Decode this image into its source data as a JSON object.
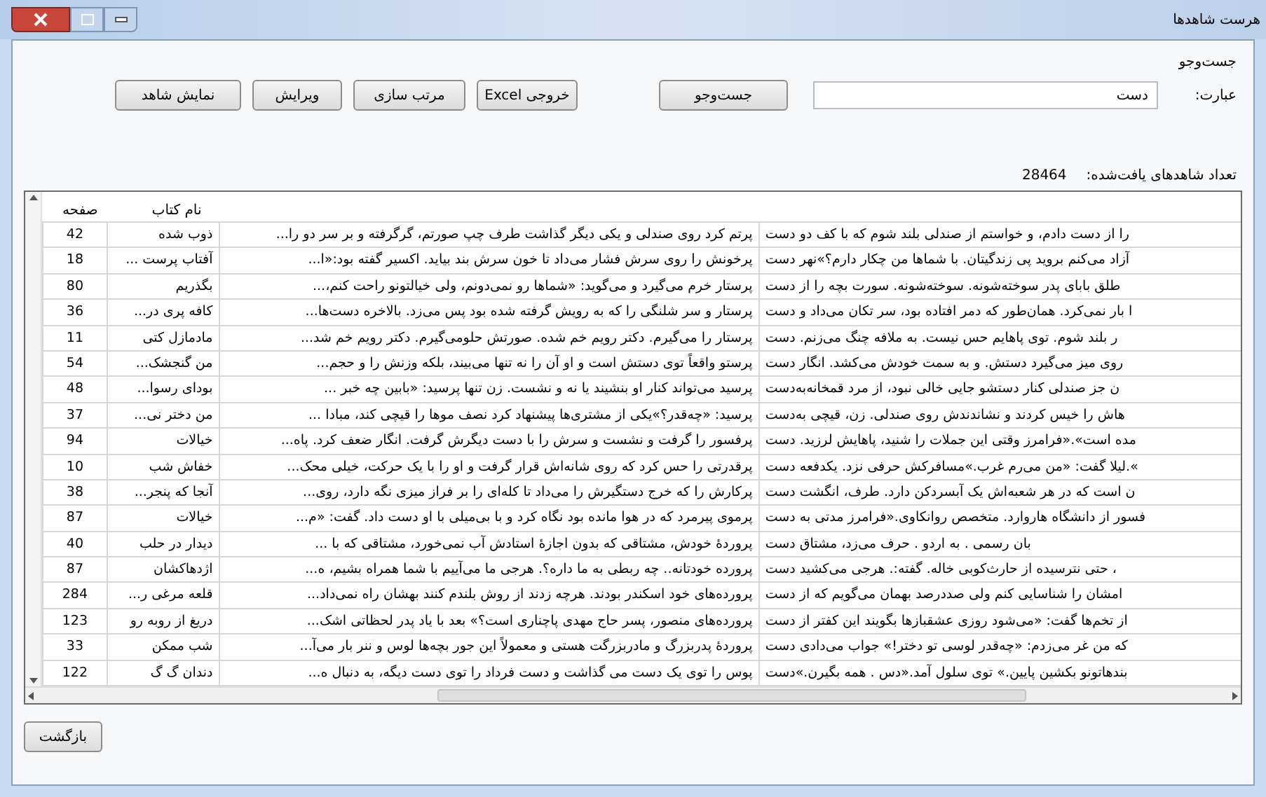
{
  "window": {
    "title": "هرست شاهدها"
  },
  "search_group": {
    "label": "جست‌وجو",
    "phrase_label": "عبارت:",
    "phrase_value": "دست",
    "search_button": "جست‌وجو",
    "buttons": [
      "خروجی Excel",
      "مرتب سازی",
      "ویرایش",
      "نمایش شاهد"
    ]
  },
  "found": {
    "label": "تعداد شاهدهای یافت‌شده:",
    "count": "28464"
  },
  "table": {
    "columns": {
      "book": "نام کتاب",
      "page": "صفحه"
    },
    "rows": [
      {
        "column_1": "را از دست دادم، و خواستم از صندلی بلند شوم که با کف دو دست",
        "column_2": "پرتم کرد روی صندلی و یکی دیگر گذاشت طرف چپ صورتم، گرگرفته و بر سر دو را...",
        "book": "ذوب شده",
        "page": "42"
      },
      {
        "column_1": "آزاد می‌کنم بروید پی زندگیتان. با شماها من چکار دارم؟»نهر دست",
        "column_2": "پرخونش را روی سرش فشار می‌داد تا خون سرش بند بیاید. اکسیر گفته بود:«ا...",
        "book": "آفتاب پرست ...",
        "page": "18"
      },
      {
        "column_1": "طلق بابای پدر سوخته‌شونه. سوخته‌شونه. سورت بچه را از دست",
        "column_2": "پرستار خرم می‌گیرد و می‌گوید: «شماها رو نمی‌دونم، ولی خیالتونو راحت کنم،...",
        "book": "بگذریم",
        "page": "80"
      },
      {
        "column_1": "ا بار نمی‌کرد. همان‌طور که دمر افتاده بود، سر تکان می‌داد و دست",
        "column_2": "پرستار و سر شلنگی را که به رویش گرفته شده بود پس می‌زد. بالاخره دست‌ها...",
        "book": "کافه پری در...",
        "page": "36"
      },
      {
        "column_1": "ر بلند شوم. توی پاهایم حس نیست. به ملافه چنگ می‌زنم. دست",
        "column_2": "پرستار را می‌گیرم. دکتر رویم خم شده. صورتش حلومی‌گیرم. دکتر رویم خم شد...",
        "book": "مادمازل کتی",
        "page": "11"
      },
      {
        "column_1": "روی میز می‌گیرد دستش. و به سمت خودش می‌کشد. انگار دست",
        "column_2": "پرستو واقعاً توی دستش است و او آن را نه تنها می‌بیند، بلکه وزنش را و حجم...",
        "book": "من گنجشک...",
        "page": "54"
      },
      {
        "column_1": "ن جز صندلی کنار دستشو جایی خالی نبود، از مرد قمخانه‌به‌دست",
        "column_2": "پرسید می‌تواند کنار او بنشیند یا نه و نشست. زن تنها پرسید: «بابین چه خبر ...",
        "book": "بودای رسوا...",
        "page": "48"
      },
      {
        "column_1": "هاش را خیس کردند و نشاندندش روی صندلی. زن، قیچی به‌دست",
        "column_2": "پرسید: «چه‌قدر؟»یکی از مشتری‌ها پیشنهاد کرد نصف موها را قیچی کند، مبادا ...",
        "book": "من دختر نی...",
        "page": "37"
      },
      {
        "column_1": "مده است».«فرامرز وقتی این جملات را شنید، پاهایش لرزید. دست",
        "column_2": "پرفسور را گرفت و نشست و سرش را با دست دیگرش گرفت. انگار ضعف کرد. پاه...",
        "book": "خیالات",
        "page": "94"
      },
      {
        "column_1": "».لیلا گفت: «من می‌رم غرب.»مسافرکش حرفی نزد. یکدفعه دست",
        "column_2": "پرقدرتی را حس کرد که روی شانه‌اش قرار گرفت و او را با یک حرکت، خیلی محک...",
        "book": "خفاش شب",
        "page": "10"
      },
      {
        "column_1": "ن است که در هر شعبه‌اش یک آبسردکن دارد. طرف، انگشت دست",
        "column_2": "پرکارش را که خرج دستگیرش را می‌داد تا کله‌ای را بر فراز میزی نگه دارد، روی...",
        "book": "آنجا که پنجر...",
        "page": "38"
      },
      {
        "column_1": "فسور از دانشگاه هاروارد. متخصص روانکاوی.«فرامرز مدتی به دست",
        "column_2": "پرموی پیرمرد که در هوا مانده بود نگاه کرد و با بی‌میلی با او دست داد. گفت: «م...",
        "book": "خیالات",
        "page": "87"
      },
      {
        "column_1": "بان رسمی . به اردو . حرف می‌زد، مشتاق دست",
        "column_2": "پروردهٔ خودش، مشتاقی که بدون اجازهٔ استادش آب نمی‌خورد، مشتاقی که با ...",
        "book": "دیدار در حلب",
        "page": "40"
      },
      {
        "column_1": "، حتی نترسیده از حارث‌کوبی خاله. گفته:. هرجی می‌کشید دست",
        "column_2": "پرورده خودتانه.. چه ربطی به ما داره؟. هرجی ما می‌آییم با شما همراه بشیم، ه...",
        "book": "اژدهاکشان",
        "page": "87"
      },
      {
        "column_1": "امشان را شناسایی کنم ولی صددرصد بهمان می‌گویم که از دست",
        "column_2": "پرورده‌های خود اسکندر بودند. هرچه زدند از روش بلندم کنند بهشان راه نمی‌داد...",
        "book": "قلعه مرغی ر...",
        "page": "284"
      },
      {
        "column_1": "از تخم‌ها گفت: «می‌شود روزی عشقبازها بگویند این کفتر از دست",
        "column_2": "پرورده‌های منصور، پسر حاج مهدی پاچناری است؟» بعد با یاد پدر لحظاتی اشک...",
        "book": "دریغ از روبه رو",
        "page": "123"
      },
      {
        "column_1": "که من غر می‌زدم: «چه‌قدر لوسی تو دختر!» جواب می‌دادی دست",
        "column_2": "پروردهٔ پدربزرگ و مادربزرگت هستی و معمولاً این جور بچه‌ها لوس و ننر بار می‌آ...",
        "book": "شب ممکن",
        "page": "33"
      },
      {
        "column_1": "بندهاتونو بکشین پایین.» توی سلول آمد.«دس . همه بگیرن.»دست",
        "column_2": "پوس را توی یک دست می گذاشت و دست فرداد را توی دست دیگه، به دنبال ه...",
        "book": "دندان گ گ",
        "page": "122"
      }
    ]
  },
  "back_button": "بازگشت"
}
